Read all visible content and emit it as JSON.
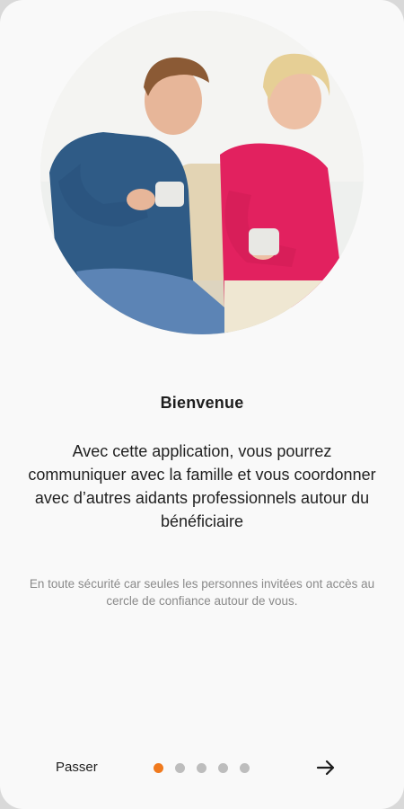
{
  "onboarding": {
    "title": "Bienvenue",
    "description": "Avec cette application, vous pourrez communiquer avec la famille et vous coordonner avec d’autres aidants professionnels autour du bénéficiaire",
    "note": "En toute sécurité car seules les personnes invitées ont accès au cercle de confiance autour de vous.",
    "skip_label": "Passer",
    "pager": {
      "total": 5,
      "current": 1
    },
    "next_icon": "arrow-right-icon",
    "hero_image": "two-people-drinking-coffee-photo"
  },
  "colors": {
    "accent": "#f07a1e",
    "dot_inactive": "#bdbdbd",
    "text": "#1e1e1e",
    "muted": "#8a8a8a"
  }
}
